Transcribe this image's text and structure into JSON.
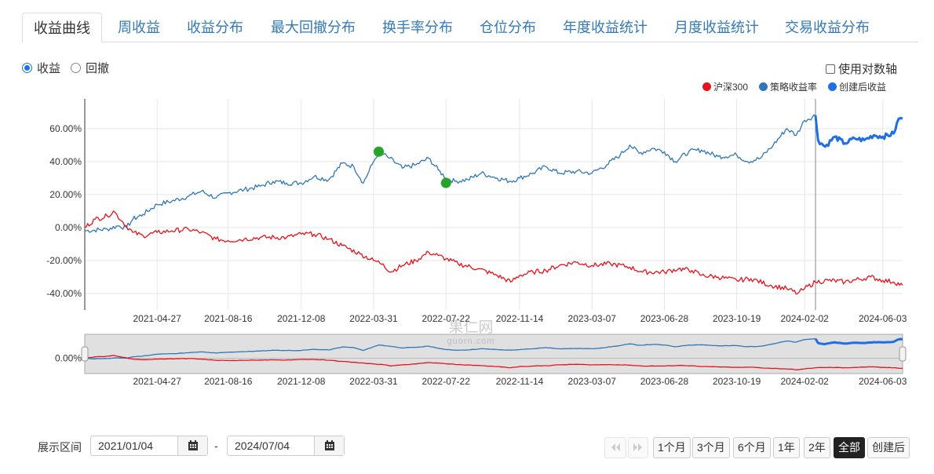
{
  "tabs": [
    "收益曲线",
    "周收益",
    "收益分布",
    "最大回撤分布",
    "换手率分布",
    "仓位分布",
    "年度收益统计",
    "月度收益统计",
    "交易收益分布"
  ],
  "radios": {
    "profit": "收益",
    "drawdown": "回撤"
  },
  "log_axis_label": "使用对数轴",
  "legend": [
    {
      "name": "沪深300",
      "color": "#e8121c"
    },
    {
      "name": "策略收益率",
      "color": "#2f77b8"
    },
    {
      "name": "创建后收益",
      "color": "#1e6ee6"
    }
  ],
  "range": {
    "label": "展示区间",
    "start": "2021/01/04",
    "dash": "-",
    "end": "2024/07/04"
  },
  "buttons": [
    "1个月",
    "3个月",
    "6个月",
    "1年",
    "2年",
    "全部",
    "创建后"
  ],
  "active_button": "全部",
  "watermark": {
    "line1": "果仁网",
    "line2": "guorn.com"
  },
  "chart_data": {
    "type": "line",
    "title": "",
    "xlabel": "",
    "ylabel": "",
    "x_ticks": [
      "2021-04-27",
      "2021-08-16",
      "2021-12-08",
      "2022-03-31",
      "2022-07-22",
      "2022-11-14",
      "2023-03-07",
      "2023-06-28",
      "2023-10-19",
      "2024-02-02",
      "2024-06-03"
    ],
    "y_ticks": [
      "60.00%",
      "40.00%",
      "20.00%",
      "0.00%",
      "-20.00%",
      "-40.00%"
    ],
    "navigator_y_tick": "0.00%",
    "ylim": [
      -50,
      78
    ],
    "x_range": [
      "2021-01-04",
      "2024-07-04"
    ],
    "create_date": "2024-02-19",
    "series": [
      {
        "name": "策略收益率",
        "color": "#2f77b8",
        "points": [
          [
            "2021-01-04",
            -2
          ],
          [
            "2021-02-08",
            -1
          ],
          [
            "2021-02-25",
            1
          ],
          [
            "2021-03-10",
            0
          ],
          [
            "2021-03-20",
            5
          ],
          [
            "2021-04-05",
            8
          ],
          [
            "2021-04-27",
            14
          ],
          [
            "2021-05-20",
            16
          ],
          [
            "2021-06-15",
            19
          ],
          [
            "2021-07-05",
            22
          ],
          [
            "2021-07-28",
            18
          ],
          [
            "2021-08-16",
            21
          ],
          [
            "2021-09-10",
            23
          ],
          [
            "2021-10-05",
            25
          ],
          [
            "2021-10-25",
            28
          ],
          [
            "2021-11-15",
            27
          ],
          [
            "2021-12-08",
            27
          ],
          [
            "2021-12-28",
            31
          ],
          [
            "2022-01-20",
            29
          ],
          [
            "2022-02-10",
            39
          ],
          [
            "2022-02-28",
            37
          ],
          [
            "2022-03-15",
            27
          ],
          [
            "2022-03-31",
            40
          ],
          [
            "2022-04-08",
            46
          ],
          [
            "2022-04-25",
            42
          ],
          [
            "2022-05-15",
            36
          ],
          [
            "2022-06-05",
            38
          ],
          [
            "2022-06-25",
            42
          ],
          [
            "2022-07-10",
            35
          ],
          [
            "2022-07-22",
            30
          ],
          [
            "2022-08-05",
            28
          ],
          [
            "2022-08-25",
            29
          ],
          [
            "2022-09-15",
            33
          ],
          [
            "2022-10-10",
            30
          ],
          [
            "2022-10-31",
            28
          ],
          [
            "2022-11-14",
            30
          ],
          [
            "2022-12-05",
            33
          ],
          [
            "2022-12-25",
            37
          ],
          [
            "2023-01-15",
            33
          ],
          [
            "2023-02-10",
            34
          ],
          [
            "2023-03-07",
            33
          ],
          [
            "2023-03-30",
            38
          ],
          [
            "2023-04-20",
            44
          ],
          [
            "2023-05-05",
            50
          ],
          [
            "2023-05-20",
            45
          ],
          [
            "2023-06-10",
            48
          ],
          [
            "2023-06-28",
            46
          ],
          [
            "2023-07-15",
            40
          ],
          [
            "2023-08-05",
            46
          ],
          [
            "2023-08-25",
            47
          ],
          [
            "2023-09-20",
            43
          ],
          [
            "2023-10-19",
            44
          ],
          [
            "2023-11-05",
            40
          ],
          [
            "2023-11-25",
            42
          ],
          [
            "2023-12-15",
            50
          ],
          [
            "2024-01-05",
            60
          ],
          [
            "2024-01-20",
            56
          ],
          [
            "2024-02-02",
            65
          ],
          [
            "2024-02-19",
            68
          ]
        ]
      },
      {
        "name": "创建后收益",
        "color": "#1e6ee6",
        "points": [
          [
            "2024-02-19",
            68
          ],
          [
            "2024-02-23",
            53
          ],
          [
            "2024-03-05",
            49
          ],
          [
            "2024-03-20",
            55
          ],
          [
            "2024-04-05",
            51
          ],
          [
            "2024-04-20",
            54
          ],
          [
            "2024-05-05",
            53
          ],
          [
            "2024-05-20",
            56
          ],
          [
            "2024-06-03",
            55
          ],
          [
            "2024-06-20",
            57
          ],
          [
            "2024-06-28",
            66
          ],
          [
            "2024-07-04",
            66
          ]
        ]
      },
      {
        "name": "沪深300",
        "color": "#e8121c",
        "points": [
          [
            "2021-01-04",
            0
          ],
          [
            "2021-01-20",
            5
          ],
          [
            "2021-02-08",
            7
          ],
          [
            "2021-02-18",
            10
          ],
          [
            "2021-03-05",
            3
          ],
          [
            "2021-03-20",
            -3
          ],
          [
            "2021-04-05",
            -5
          ],
          [
            "2021-04-27",
            -3
          ],
          [
            "2021-05-20",
            -2
          ],
          [
            "2021-06-15",
            -1
          ],
          [
            "2021-07-05",
            -3
          ],
          [
            "2021-07-28",
            -7
          ],
          [
            "2021-08-16",
            -8
          ],
          [
            "2021-09-10",
            -7
          ],
          [
            "2021-10-05",
            -6
          ],
          [
            "2021-11-15",
            -6
          ],
          [
            "2021-12-08",
            -4
          ],
          [
            "2021-12-28",
            -4
          ],
          [
            "2022-01-20",
            -7
          ],
          [
            "2022-02-10",
            -11
          ],
          [
            "2022-03-10",
            -16
          ],
          [
            "2022-03-31",
            -20
          ],
          [
            "2022-04-15",
            -22
          ],
          [
            "2022-04-26",
            -27
          ],
          [
            "2022-05-15",
            -23
          ],
          [
            "2022-06-05",
            -20
          ],
          [
            "2022-06-25",
            -15
          ],
          [
            "2022-07-10",
            -17
          ],
          [
            "2022-07-22",
            -19
          ],
          [
            "2022-08-10",
            -22
          ],
          [
            "2022-09-10",
            -25
          ],
          [
            "2022-10-10",
            -29
          ],
          [
            "2022-10-31",
            -33
          ],
          [
            "2022-11-14",
            -29
          ],
          [
            "2022-12-05",
            -27
          ],
          [
            "2022-12-25",
            -26
          ],
          [
            "2023-01-15",
            -23
          ],
          [
            "2023-02-10",
            -21
          ],
          [
            "2023-03-07",
            -23
          ],
          [
            "2023-04-05",
            -22
          ],
          [
            "2023-05-05",
            -24
          ],
          [
            "2023-05-25",
            -27
          ],
          [
            "2023-06-28",
            -27
          ],
          [
            "2023-07-20",
            -25
          ],
          [
            "2023-08-10",
            -26
          ],
          [
            "2023-08-25",
            -29
          ],
          [
            "2023-09-20",
            -30
          ],
          [
            "2023-10-19",
            -32
          ],
          [
            "2023-11-10",
            -31
          ],
          [
            "2023-12-10",
            -35
          ],
          [
            "2024-01-05",
            -37
          ],
          [
            "2024-01-22",
            -40
          ],
          [
            "2024-02-02",
            -37
          ],
          [
            "2024-02-19",
            -33
          ],
          [
            "2024-03-10",
            -32
          ],
          [
            "2024-04-05",
            -33
          ],
          [
            "2024-05-15",
            -30
          ],
          [
            "2024-06-03",
            -32
          ],
          [
            "2024-06-20",
            -33
          ],
          [
            "2024-07-04",
            -35
          ]
        ]
      }
    ],
    "markers": [
      {
        "date": "2022-04-08",
        "value": 46,
        "color": "#25a32b"
      },
      {
        "date": "2022-07-22",
        "value": 27,
        "color": "#25a32b"
      }
    ]
  }
}
